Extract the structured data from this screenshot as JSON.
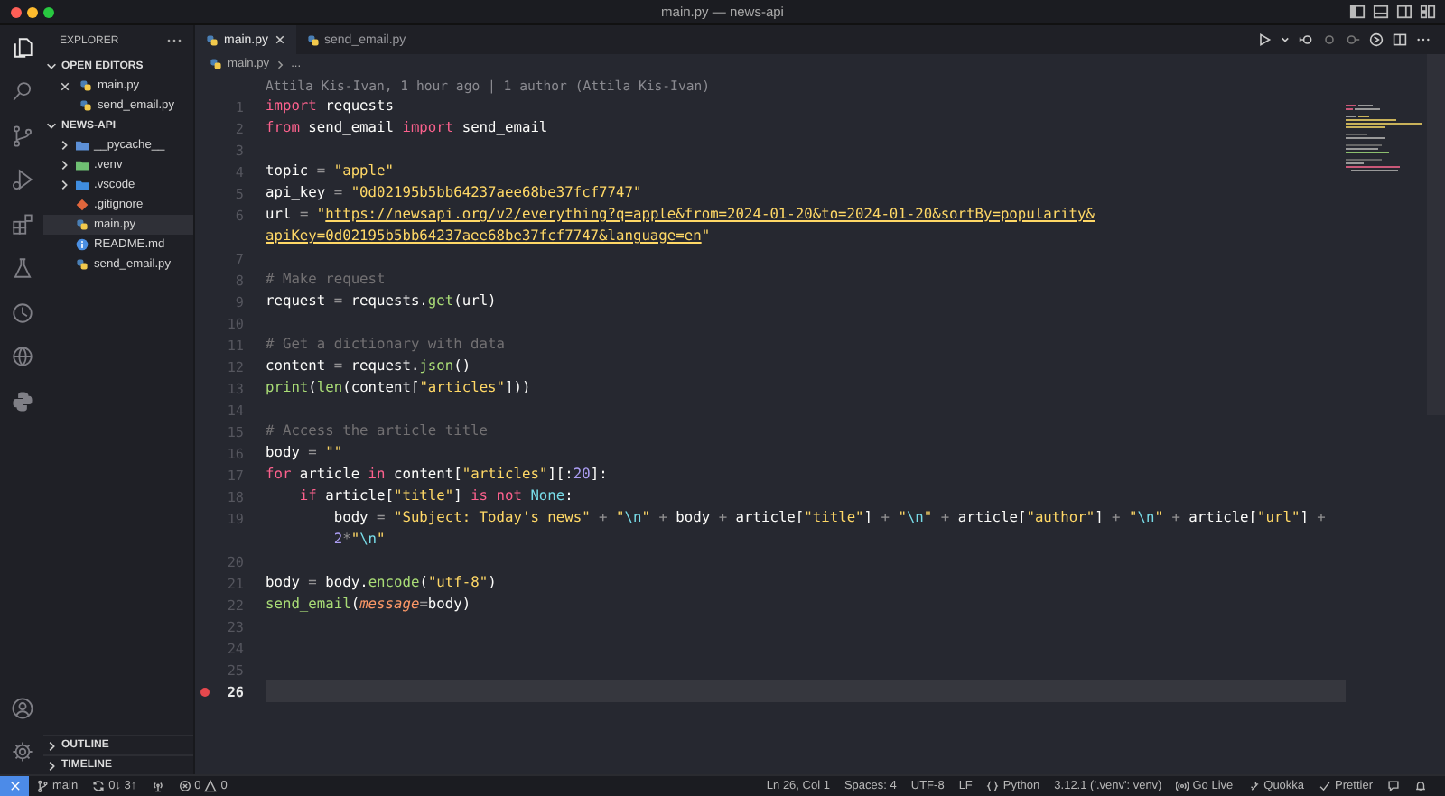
{
  "window": {
    "title": "main.py — news-api"
  },
  "activity_bar": {
    "top": [
      {
        "kind": "explorer",
        "selected": true
      },
      {
        "kind": "search",
        "selected": false
      },
      {
        "kind": "scm",
        "selected": false
      },
      {
        "kind": "debug",
        "selected": false
      },
      {
        "kind": "extensions",
        "selected": false
      },
      {
        "kind": "flask",
        "selected": false
      },
      {
        "kind": "clock",
        "selected": false
      },
      {
        "kind": "globe",
        "selected": false
      },
      {
        "kind": "python",
        "selected": false
      }
    ],
    "bottom": [
      {
        "kind": "account"
      },
      {
        "kind": "settings"
      }
    ]
  },
  "sidebar": {
    "title": "EXPLORER",
    "open_editors": {
      "title": "OPEN EDITORS",
      "expanded": true,
      "items": [
        {
          "label": "main.py",
          "kind": "python",
          "active": true
        },
        {
          "label": "send_email.py",
          "kind": "python",
          "active": false
        }
      ]
    },
    "folder": {
      "title": "NEWS-API",
      "expanded": true,
      "children": [
        {
          "label": "__pycache__",
          "kind": "pycache-folder",
          "expanded": false,
          "selected": false
        },
        {
          "label": ".venv",
          "kind": "venv-folder",
          "expanded": false,
          "selected": false
        },
        {
          "label": ".vscode",
          "kind": "vscode-folder",
          "expanded": false,
          "selected": false
        },
        {
          "label": ".gitignore",
          "kind": "git",
          "selected": false
        },
        {
          "label": "main.py",
          "kind": "python",
          "selected": true
        },
        {
          "label": "README.md",
          "kind": "info",
          "selected": false
        },
        {
          "label": "send_email.py",
          "kind": "python",
          "selected": false
        }
      ]
    },
    "bottom_sections": [
      {
        "title": "OUTLINE",
        "expanded": false
      },
      {
        "title": "TIMELINE",
        "expanded": false
      }
    ]
  },
  "tabs": [
    {
      "label": "main.py",
      "selected": true
    },
    {
      "label": "send_email.py",
      "selected": false
    }
  ],
  "breadcrumb": [
    "main.py",
    "..."
  ],
  "editor": {
    "blame": "Attila Kis-Ivan, 1 hour ago | 1 author (Attila Kis-Ivan)",
    "lines": [
      {
        "number": "1",
        "tokens": [
          {
            "kind": "keyword",
            "text": "import"
          },
          {
            "kind": "text",
            "text": " requests"
          }
        ],
        "breakpoint": false,
        "current": false
      },
      {
        "number": "2",
        "tokens": [
          {
            "kind": "keyword",
            "text": "from"
          },
          {
            "kind": "text",
            "text": " send_email "
          },
          {
            "kind": "keyword",
            "text": "import"
          },
          {
            "kind": "text",
            "text": " send_email"
          }
        ],
        "breakpoint": false,
        "current": false
      },
      {
        "number": "3",
        "breakpoint": false,
        "current": false
      },
      {
        "number": "4",
        "tokens": [
          {
            "kind": "text",
            "text": "topic "
          },
          {
            "kind": "operator",
            "text": "= "
          },
          {
            "kind": "string",
            "text": "\"apple\""
          }
        ],
        "breakpoint": false,
        "current": false
      },
      {
        "number": "5",
        "tokens": [
          {
            "kind": "text",
            "text": "api_key "
          },
          {
            "kind": "operator",
            "text": "= "
          },
          {
            "kind": "string",
            "text": "\"0d02195b5bb64237aee68be37fcf7747\""
          }
        ],
        "breakpoint": false,
        "current": false
      },
      {
        "number": "6",
        "tokens": [
          {
            "kind": "text",
            "text": "url "
          },
          {
            "kind": "operator",
            "text": "= "
          },
          {
            "kind": "string",
            "text": "\""
          },
          {
            "kind": "link",
            "text": "https://newsapi.org/v2/everything?q=apple&from=2024-01-20&to=2024-01-20&sortBy=popularity&"
          }
        ],
        "wrap": [
          {
            "kind": "link",
            "text": "apiKey=0d02195b5bb64237aee68be37fcf7747&language=en"
          },
          {
            "kind": "string",
            "text": "\""
          }
        ],
        "breakpoint": false,
        "current": false
      },
      {
        "number": "7",
        "breakpoint": false,
        "current": false
      },
      {
        "number": "8",
        "tokens": [
          {
            "kind": "comment",
            "text": "# Make request"
          }
        ],
        "breakpoint": false,
        "current": false
      },
      {
        "number": "9",
        "tokens": [
          {
            "kind": "text",
            "text": "request "
          },
          {
            "kind": "operator",
            "text": "= "
          },
          {
            "kind": "text",
            "text": "requests."
          },
          {
            "kind": "function",
            "text": "get"
          },
          {
            "kind": "text",
            "text": "(url)"
          }
        ],
        "breakpoint": false,
        "current": false
      },
      {
        "number": "10",
        "breakpoint": false,
        "current": false
      },
      {
        "number": "11",
        "tokens": [
          {
            "kind": "comment",
            "text": "# Get a dictionary with data"
          }
        ],
        "breakpoint": false,
        "current": false
      },
      {
        "number": "12",
        "tokens": [
          {
            "kind": "text",
            "text": "content "
          },
          {
            "kind": "operator",
            "text": "= "
          },
          {
            "kind": "text",
            "text": "request."
          },
          {
            "kind": "function",
            "text": "json"
          },
          {
            "kind": "text",
            "text": "()"
          }
        ],
        "breakpoint": false,
        "current": false
      },
      {
        "number": "13",
        "tokens": [
          {
            "kind": "function",
            "text": "print"
          },
          {
            "kind": "text",
            "text": "("
          },
          {
            "kind": "function",
            "text": "len"
          },
          {
            "kind": "text",
            "text": "(content["
          },
          {
            "kind": "string",
            "text": "\"articles\""
          },
          {
            "kind": "text",
            "text": "]))"
          }
        ],
        "breakpoint": false,
        "current": false
      },
      {
        "number": "14",
        "breakpoint": false,
        "current": false
      },
      {
        "number": "15",
        "tokens": [
          {
            "kind": "comment",
            "text": "# Access the article title"
          }
        ],
        "breakpoint": false,
        "current": false
      },
      {
        "number": "16",
        "tokens": [
          {
            "kind": "text",
            "text": "body "
          },
          {
            "kind": "operator",
            "text": "= "
          },
          {
            "kind": "string",
            "text": "\"\""
          }
        ],
        "breakpoint": false,
        "current": false
      },
      {
        "number": "17",
        "tokens": [
          {
            "kind": "keyword",
            "text": "for"
          },
          {
            "kind": "text",
            "text": " article "
          },
          {
            "kind": "keyword",
            "text": "in"
          },
          {
            "kind": "text",
            "text": " content["
          },
          {
            "kind": "string",
            "text": "\"articles\""
          },
          {
            "kind": "text",
            "text": "][:"
          },
          {
            "kind": "number",
            "text": "20"
          },
          {
            "kind": "text",
            "text": "]:"
          }
        ],
        "breakpoint": false,
        "current": false
      },
      {
        "number": "18",
        "tokens": [
          {
            "kind": "keyword",
            "text": "    if"
          },
          {
            "kind": "text",
            "text": " article["
          },
          {
            "kind": "string",
            "text": "\"title\""
          },
          {
            "kind": "text",
            "text": "] "
          },
          {
            "kind": "keyword",
            "text": "is not "
          },
          {
            "kind": "builtin",
            "text": "None"
          },
          {
            "kind": "text",
            "text": ":"
          }
        ],
        "breakpoint": false,
        "current": false
      },
      {
        "number": "19",
        "tokens": [
          {
            "kind": "text",
            "text": "        body "
          },
          {
            "kind": "operator",
            "text": "= "
          },
          {
            "kind": "string",
            "text": "\"Subject: Today's news\" "
          },
          {
            "kind": "operator",
            "text": "+ "
          },
          {
            "kind": "string",
            "text": "\""
          },
          {
            "kind": "escape",
            "text": "\\n"
          },
          {
            "kind": "string",
            "text": "\" "
          },
          {
            "kind": "operator",
            "text": "+ "
          },
          {
            "kind": "text",
            "text": "body "
          },
          {
            "kind": "operator",
            "text": "+ "
          },
          {
            "kind": "text",
            "text": "article["
          },
          {
            "kind": "string",
            "text": "\"title\""
          },
          {
            "kind": "text",
            "text": "] "
          },
          {
            "kind": "operator",
            "text": "+ "
          },
          {
            "kind": "string",
            "text": "\""
          },
          {
            "kind": "escape",
            "text": "\\n"
          },
          {
            "kind": "string",
            "text": "\" "
          },
          {
            "kind": "operator",
            "text": "+ "
          },
          {
            "kind": "text",
            "text": "article["
          },
          {
            "kind": "string",
            "text": "\"author\""
          },
          {
            "kind": "text",
            "text": "] "
          },
          {
            "kind": "operator",
            "text": "+ "
          },
          {
            "kind": "string",
            "text": "\""
          },
          {
            "kind": "escape",
            "text": "\\n"
          },
          {
            "kind": "string",
            "text": "\" "
          },
          {
            "kind": "operator",
            "text": "+ "
          },
          {
            "kind": "text",
            "text": "article["
          },
          {
            "kind": "string",
            "text": "\"url\""
          },
          {
            "kind": "text",
            "text": "] "
          },
          {
            "kind": "operator",
            "text": "+"
          }
        ],
        "wrap": [
          {
            "kind": "number",
            "text": "        2"
          },
          {
            "kind": "operator",
            "text": "*"
          },
          {
            "kind": "string",
            "text": "\""
          },
          {
            "kind": "escape",
            "text": "\\n"
          },
          {
            "kind": "string",
            "text": "\""
          }
        ],
        "breakpoint": false,
        "current": false
      },
      {
        "number": "20",
        "breakpoint": false,
        "current": false
      },
      {
        "number": "21",
        "tokens": [
          {
            "kind": "text",
            "text": "body "
          },
          {
            "kind": "operator",
            "text": "= "
          },
          {
            "kind": "text",
            "text": "body."
          },
          {
            "kind": "function",
            "text": "encode"
          },
          {
            "kind": "text",
            "text": "("
          },
          {
            "kind": "string",
            "text": "\"utf-8\""
          },
          {
            "kind": "text",
            "text": ")"
          }
        ],
        "breakpoint": false,
        "current": false
      },
      {
        "number": "22",
        "tokens": [
          {
            "kind": "function",
            "text": "send_email"
          },
          {
            "kind": "text",
            "text": "("
          },
          {
            "kind": "param",
            "text": "message"
          },
          {
            "kind": "operator",
            "text": "="
          },
          {
            "kind": "text",
            "text": "body)"
          }
        ],
        "breakpoint": false,
        "current": false
      },
      {
        "number": "23",
        "breakpoint": false,
        "current": false
      },
      {
        "number": "24",
        "breakpoint": false,
        "current": false
      },
      {
        "number": "25",
        "breakpoint": false,
        "current": false
      },
      {
        "number": "26",
        "breakpoint": true,
        "current": true
      }
    ]
  },
  "status_bar": {
    "left": [
      {
        "kind": "remote"
      },
      {
        "kind": "branch",
        "text": "main"
      },
      {
        "kind": "sync",
        "text": "0↓ 3↑"
      },
      {
        "kind": "ports"
      },
      {
        "kind": "problems",
        "errors": "0",
        "warnings": "0"
      }
    ],
    "right": [
      {
        "kind": "plain",
        "text": "Ln 26, Col 1"
      },
      {
        "kind": "plain",
        "text": "Spaces: 4"
      },
      {
        "kind": "plain",
        "text": "UTF-8"
      },
      {
        "kind": "plain",
        "text": "LF"
      },
      {
        "kind": "language",
        "text": "Python"
      },
      {
        "kind": "plain",
        "text": "3.12.1 ('.venv': venv)"
      },
      {
        "kind": "live",
        "text": "Go Live"
      },
      {
        "kind": "quokka",
        "text": "Quokka"
      },
      {
        "kind": "check",
        "text": "Prettier"
      },
      {
        "kind": "feedback"
      },
      {
        "kind": "bell"
      }
    ]
  }
}
